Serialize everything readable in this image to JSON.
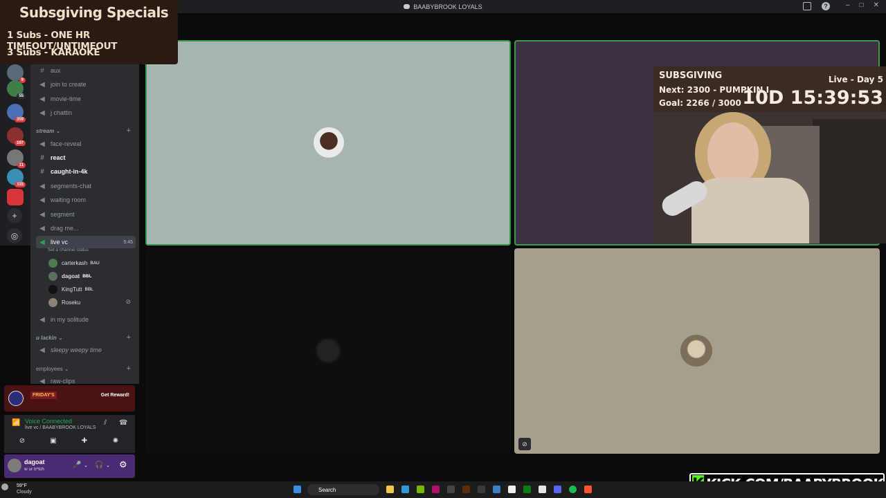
{
  "window": {
    "title": "BAABYBROOK LOYALS"
  },
  "overlay_specials": {
    "title": "Subsgiving Specials",
    "lines": [
      "1 Subs - ONE HR TIMEOUT/UNTIMEOUT",
      "3 Subs - KARAOKE"
    ]
  },
  "servers": {
    "badges": [
      "9",
      "55",
      "359",
      "107",
      "11",
      "115"
    ]
  },
  "channels": {
    "list_a": [
      {
        "icon": "hashtag-icon",
        "label": "aux"
      },
      {
        "icon": "speaker-icon",
        "label": "join to create"
      },
      {
        "icon": "speaker-icon",
        "label": "movie-time"
      },
      {
        "icon": "speaker-icon",
        "label": "j chattin"
      }
    ],
    "cat_stream": "stream",
    "list_b": [
      {
        "icon": "speaker-icon",
        "label": "face-reveal"
      },
      {
        "icon": "hashtag-icon",
        "label": "react"
      },
      {
        "icon": "hashtag-icon",
        "label": "caught-in-4k"
      },
      {
        "icon": "speaker-icon",
        "label": "segments-chat"
      },
      {
        "icon": "speaker-icon",
        "label": "waiting room"
      },
      {
        "icon": "speaker-icon",
        "label": "segment"
      },
      {
        "icon": "speaker-icon",
        "label": "drag me..."
      }
    ],
    "live_vc": {
      "label": "live vc",
      "time": "5:45",
      "status": "Set a channel status"
    },
    "voice_users": [
      {
        "name": "carterkash",
        "tag": "BAU"
      },
      {
        "name": "dagoat",
        "tag": "BBL"
      },
      {
        "name": "KingTutt",
        "tag": "BBL"
      },
      {
        "name": "Roseku",
        "tag": ""
      }
    ],
    "in_my_solitude": "in my solitude",
    "cat_ulackin": "u lackin",
    "sleepy": "sleepy weepy time",
    "cat_employees": "employees",
    "raw_clips": "raw-clips"
  },
  "promo": {
    "art_text": "FRIDAY'S",
    "button": "Get Reward!"
  },
  "voice": {
    "status": "Voice Connected",
    "channel": "live vc / BAABYBROOK LOYALS"
  },
  "user": {
    "name": "dagoat",
    "status": "w ur b*tch"
  },
  "subsgiving": {
    "title": "SUBSGIVING",
    "next": "Next: 2300 - PUMPKIN I",
    "goal": "Goal: 2266 / 3000",
    "live": "Live - Day 5",
    "clock": "10D 15:39:53"
  },
  "kick": {
    "url": "KICK.COM/BAABYBROOK"
  },
  "taskbar": {
    "temp": "59°F",
    "weather": "Cloudy",
    "search": "Search"
  },
  "colors": {
    "speaking_border": "#3a9b4b",
    "discord_sidebar": "#2b2d31",
    "voice_green": "#23a55a",
    "kick_green": "#53fc18"
  }
}
